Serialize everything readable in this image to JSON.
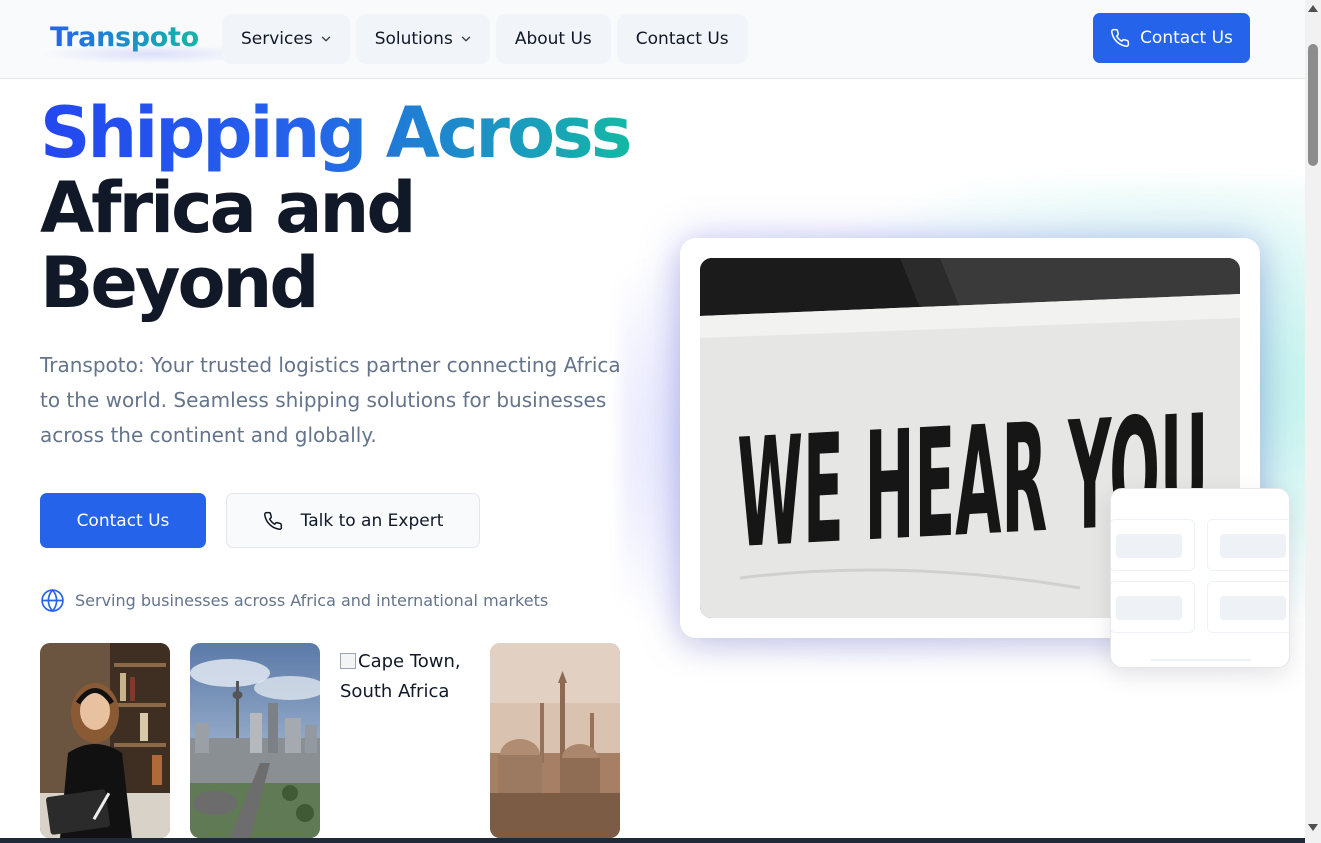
{
  "brand": {
    "name": "Transpoto"
  },
  "nav": {
    "items": [
      {
        "label": "Services",
        "has_dropdown": true
      },
      {
        "label": "Solutions",
        "has_dropdown": true
      },
      {
        "label": "About Us",
        "has_dropdown": false
      },
      {
        "label": "Contact Us",
        "has_dropdown": false
      }
    ],
    "cta_label": "Contact Us",
    "cta_icon": "phone-icon"
  },
  "hero": {
    "title_gradient": "Shipping Across",
    "title_rest_line1": "Africa and",
    "title_rest_line2": "Beyond",
    "description": "Transpoto: Your trusted logistics partner connecting Africa to the world. Seamless shipping solutions for businesses across the continent and globally.",
    "primary_button": "Contact Us",
    "secondary_button": "Talk to an Expert",
    "secondary_icon": "phone-icon",
    "serving_text": "Serving businesses across Africa and international markets",
    "serving_icon": "globe-icon"
  },
  "thumbnails": {
    "broken_image_alt": "Cape Town, South Africa"
  },
  "feature_image": {
    "sign_text": "WE HEAR YOU"
  },
  "colors": {
    "accent": "#2563eb",
    "gradient_end": "#14b8a6",
    "text_dark": "#111827",
    "text_muted": "#64748b"
  }
}
